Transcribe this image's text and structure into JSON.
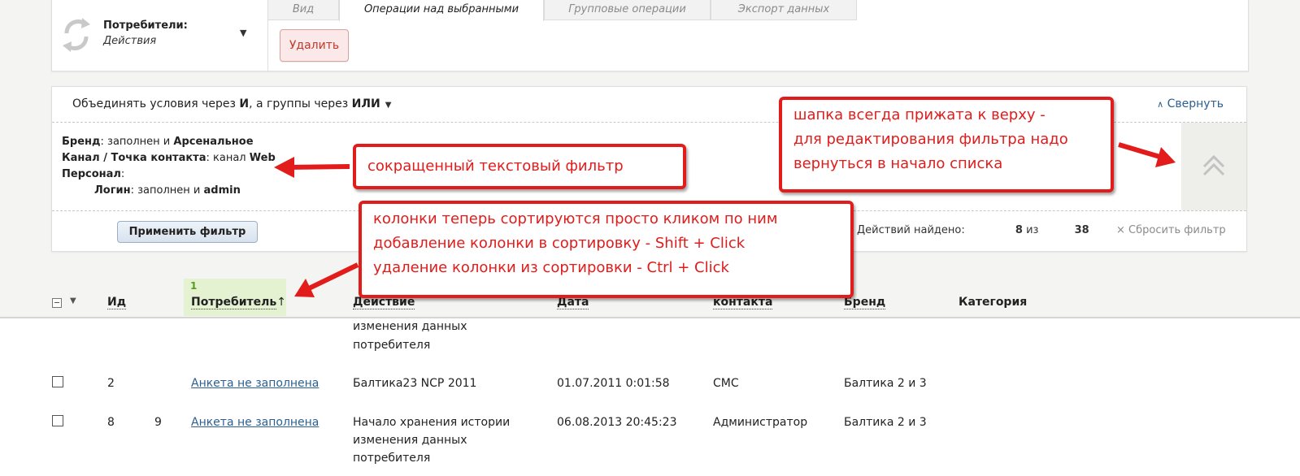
{
  "module": {
    "title": "Потребители:",
    "subtitle": "Действия"
  },
  "tabs": [
    {
      "label": "Вид",
      "active": false
    },
    {
      "label": "Операции над выбранными",
      "active": true
    },
    {
      "label": "Групповые операции",
      "active": false
    },
    {
      "label": "Экспорт данных",
      "active": false
    }
  ],
  "actions": {
    "delete_label": "Удалить"
  },
  "filter": {
    "combine_prefix": "Объединять условия через ",
    "combine_and": "И",
    "combine_mid": ", а группы через ",
    "combine_or": "ИЛИ",
    "collapse_label": "Свернуть",
    "conditions": {
      "brand_label": "Бренд",
      "brand_text": ": заполнен и ",
      "brand_value": "Арсенальное",
      "channel_label": "Канал / Точка контакта",
      "channel_text": ": канал ",
      "channel_value": "Web",
      "staff_label": "Персонал",
      "staff_text": ":",
      "login_label": "Логин",
      "login_text": ": заполнен и ",
      "login_value": "admin"
    },
    "apply_label": "Применить фильтр",
    "found_prefix": "Действий найдено: ",
    "found_count": "8",
    "found_of": " из ",
    "found_total": "38",
    "reset_label": "× Сбросить фильтр"
  },
  "table": {
    "sort_order": "1",
    "columns": [
      "Ид",
      "Потребитель",
      "Действие",
      "Дата",
      "контакта",
      "Бренд",
      "Категория"
    ],
    "sort_arrow": "↑",
    "partial_row": {
      "action_line1": "изменения данных",
      "action_line2": "потребителя"
    },
    "rows": [
      {
        "id": "2",
        "consumer": "Анкета не заполнена",
        "action": "Балтика23 NCP 2011",
        "date": "01.07.2011 0:01:58",
        "contact": "СМС",
        "brand": "Балтика 2 и 3"
      },
      {
        "id": "8",
        "id_extra": "9",
        "consumer": "Анкета не заполнена",
        "action_line1": "Начало хранения истории",
        "action_line2": "изменения данных",
        "action_line3": "потребителя",
        "date": "06.08.2013 20:45:23",
        "contact": "Администратор",
        "brand": "Балтика 2 и 3"
      }
    ]
  },
  "callouts": {
    "short_filter": "сокращенный текстовый фильтр",
    "header_line1": "шапка всегда прижата к верху -",
    "header_line2": "для редактирования фильтра надо",
    "header_line3": "вернуться в начало списка",
    "sort_line1": "колонки теперь сортируются просто кликом по ним",
    "sort_line2": "добавление колонки в сортировку - Shift + Click",
    "sort_line3": "удаление колонки из сортировки - Ctrl + Click"
  },
  "colors": {
    "callout": "#e21b1b",
    "link": "#2b5f92",
    "sorted_column": "#e4f2d2"
  }
}
